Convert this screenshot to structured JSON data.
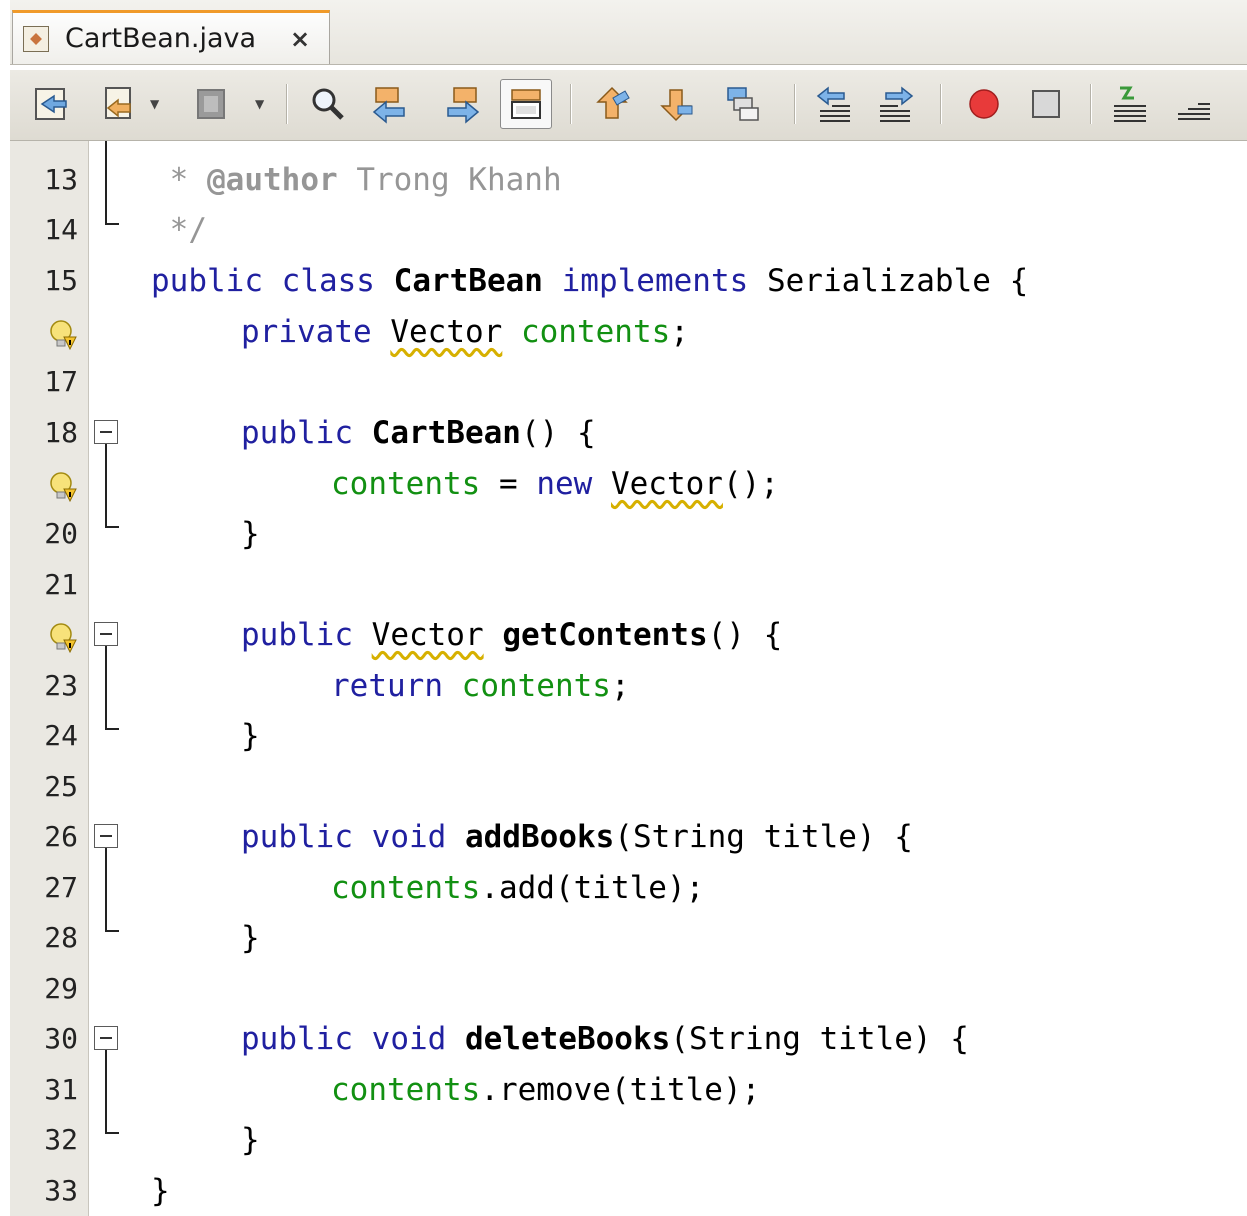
{
  "tab": {
    "title": "CartBean.java",
    "close": "×"
  },
  "toolbar": {
    "icons": [
      "last-edit-icon",
      "back-icon",
      "forward-icon",
      "find-icon",
      "find-previous-icon",
      "find-next-icon",
      "toggle-highlight-icon",
      "previous-bookmark-icon",
      "next-bookmark-icon",
      "toggle-bookmark-icon",
      "shift-left-icon",
      "shift-right-icon",
      "start-macro-icon",
      "stop-macro-icon",
      "comment-icon",
      "uncomment-icon"
    ]
  },
  "lines": [
    {
      "n": "13"
    },
    {
      "n": "14"
    },
    {
      "n": "15"
    },
    {
      "n": "",
      "hint": true
    },
    {
      "n": "17"
    },
    {
      "n": "18"
    },
    {
      "n": "",
      "hint": true
    },
    {
      "n": "20"
    },
    {
      "n": "21"
    },
    {
      "n": "",
      "hint": true
    },
    {
      "n": "23"
    },
    {
      "n": "24"
    },
    {
      "n": "25"
    },
    {
      "n": "26"
    },
    {
      "n": "27"
    },
    {
      "n": "28"
    },
    {
      "n": "29"
    },
    {
      "n": "30"
    },
    {
      "n": "31"
    },
    {
      "n": "32"
    },
    {
      "n": "33"
    }
  ],
  "code": {
    "l13_star": " * ",
    "l13_tag": "@author",
    "l13_rest": " Trong Khanh",
    "l14": " */",
    "l15_public": "public",
    "l15_class": "class",
    "l15_name": "CartBean",
    "l15_implements": "implements",
    "l15_rest": "Serializable {",
    "l16_private": "private",
    "l16_type": "Vector",
    "l16_field": "contents",
    "l16_semi": ";",
    "l18_public": "public",
    "l18_name": "CartBean",
    "l18_rest": "() {",
    "l19_field": "contents",
    "l19_eq": " = ",
    "l19_new": "new",
    "l19_type": "Vector",
    "l19_rest": "();",
    "l20": "}",
    "l22_public": "public",
    "l22_type": "Vector",
    "l22_name": "getContents",
    "l22_rest": "() {",
    "l23_return": "return",
    "l23_field": "contents",
    "l23_semi": ";",
    "l24": "}",
    "l26_public": "public",
    "l26_void": "void",
    "l26_name": "addBooks",
    "l26_rest": "(String title) {",
    "l27_field": "contents",
    "l27_rest": ".add(title);",
    "l28": "}",
    "l30_public": "public",
    "l30_void": "void",
    "l30_name": "deleteBooks",
    "l30_rest": "(String title) {",
    "l31_field": "contents",
    "l31_rest": ".remove(title);",
    "l32": "}",
    "l33": "}"
  },
  "colors": {
    "keyword": "#2020a0",
    "field": "#129012",
    "comment": "#969696",
    "tab_accent": "#f09a2a",
    "warning": "#d6b000"
  }
}
